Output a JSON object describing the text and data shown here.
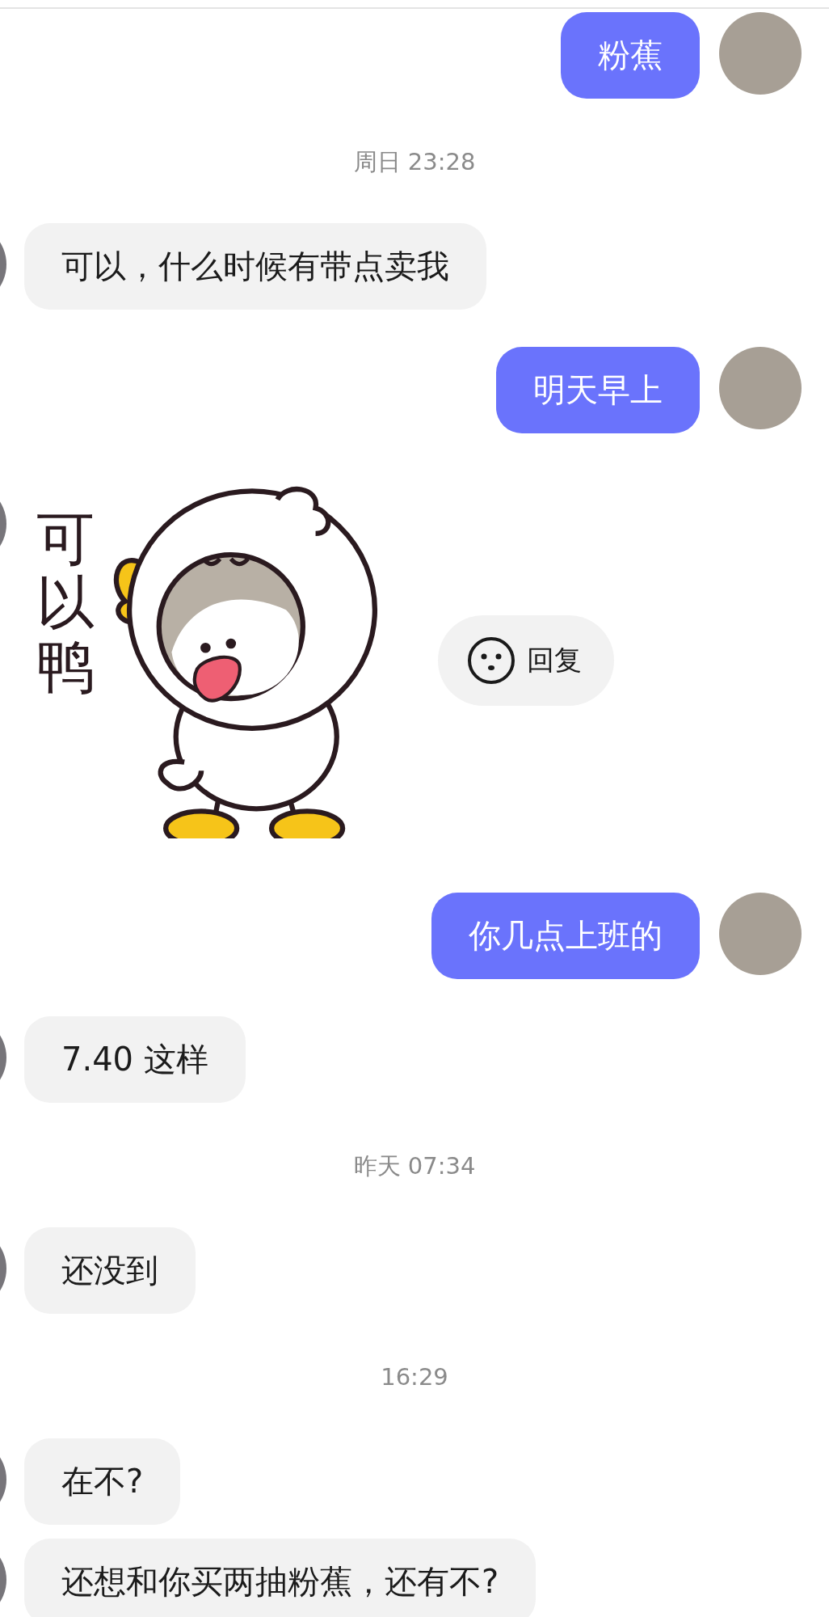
{
  "messages": [
    {
      "kind": "text",
      "outgoing": true,
      "text": "粉蕉"
    },
    {
      "kind": "time",
      "text": "周日 23:28"
    },
    {
      "kind": "text",
      "outgoing": false,
      "text": "可以，什么时候有带点卖我"
    },
    {
      "kind": "text",
      "outgoing": true,
      "text": "明天早上"
    },
    {
      "kind": "sticker",
      "outgoing": false,
      "caption": "可以鸭",
      "reply_label": "回复"
    },
    {
      "kind": "text",
      "outgoing": true,
      "text": "你几点上班的"
    },
    {
      "kind": "text",
      "outgoing": false,
      "text": "7.40 这样"
    },
    {
      "kind": "time",
      "text": "昨天 07:34"
    },
    {
      "kind": "text",
      "outgoing": false,
      "text": "还没到"
    },
    {
      "kind": "time",
      "text": "16:29"
    },
    {
      "kind": "text",
      "outgoing": false,
      "text": "在不?"
    },
    {
      "kind": "text",
      "outgoing": false,
      "text": "还想和你买两抽粉蕉，还有不?"
    }
  ]
}
